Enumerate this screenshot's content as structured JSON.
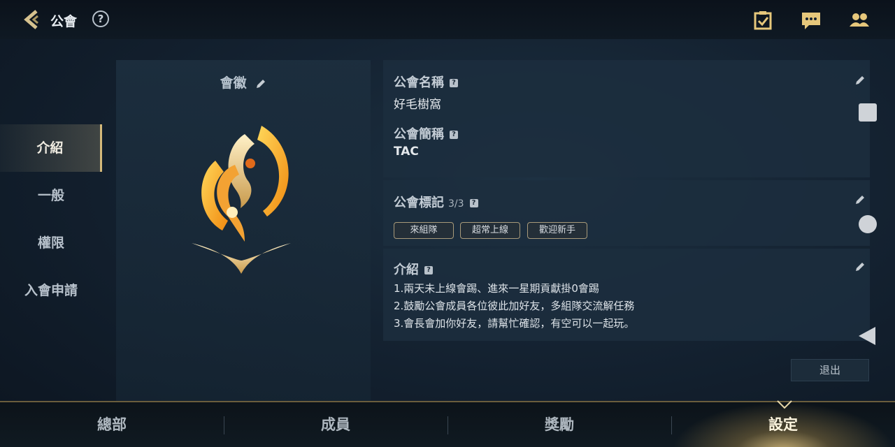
{
  "header": {
    "title": "公會",
    "help_label": "?"
  },
  "sidebar": {
    "items": [
      {
        "label": "介紹",
        "active": true
      },
      {
        "label": "一般",
        "active": false
      },
      {
        "label": "權限",
        "active": false
      },
      {
        "label": "入會申請",
        "active": false
      }
    ]
  },
  "emblem": {
    "label": "會徽"
  },
  "guild_name": {
    "title": "公會名稱",
    "help": "?",
    "value": "好毛樹窩"
  },
  "guild_short": {
    "title": "公會簡稱",
    "help": "?",
    "value": "TAC"
  },
  "guild_tags": {
    "title": "公會標記",
    "count": "3/3",
    "help": "?",
    "tags": [
      "來組隊",
      "超常上線",
      "歡迎新手"
    ]
  },
  "intro": {
    "title": "介紹",
    "help": "?",
    "lines": [
      "1.兩天未上線會踢、進來一星期貢獻掛0會踢",
      "2.鼓勵公會成員各位彼此加好友，多組隊交流解任務",
      "3.會長會加你好友，請幫忙確認，有空可以一起玩。"
    ]
  },
  "exit_label": "退出",
  "bottom_tabs": [
    {
      "label": "總部",
      "active": false
    },
    {
      "label": "成員",
      "active": false
    },
    {
      "label": "獎勵",
      "active": false
    },
    {
      "label": "設定",
      "active": true
    }
  ],
  "colors": {
    "accent_gold": "#d4b97a",
    "emblem_orange": "#f0a020",
    "background": "#142231"
  },
  "icons": [
    "back-chevron-icon",
    "help-icon",
    "checklist-icon",
    "chat-icon",
    "friends-icon",
    "edit-pencil-icon",
    "guild-emblem"
  ]
}
